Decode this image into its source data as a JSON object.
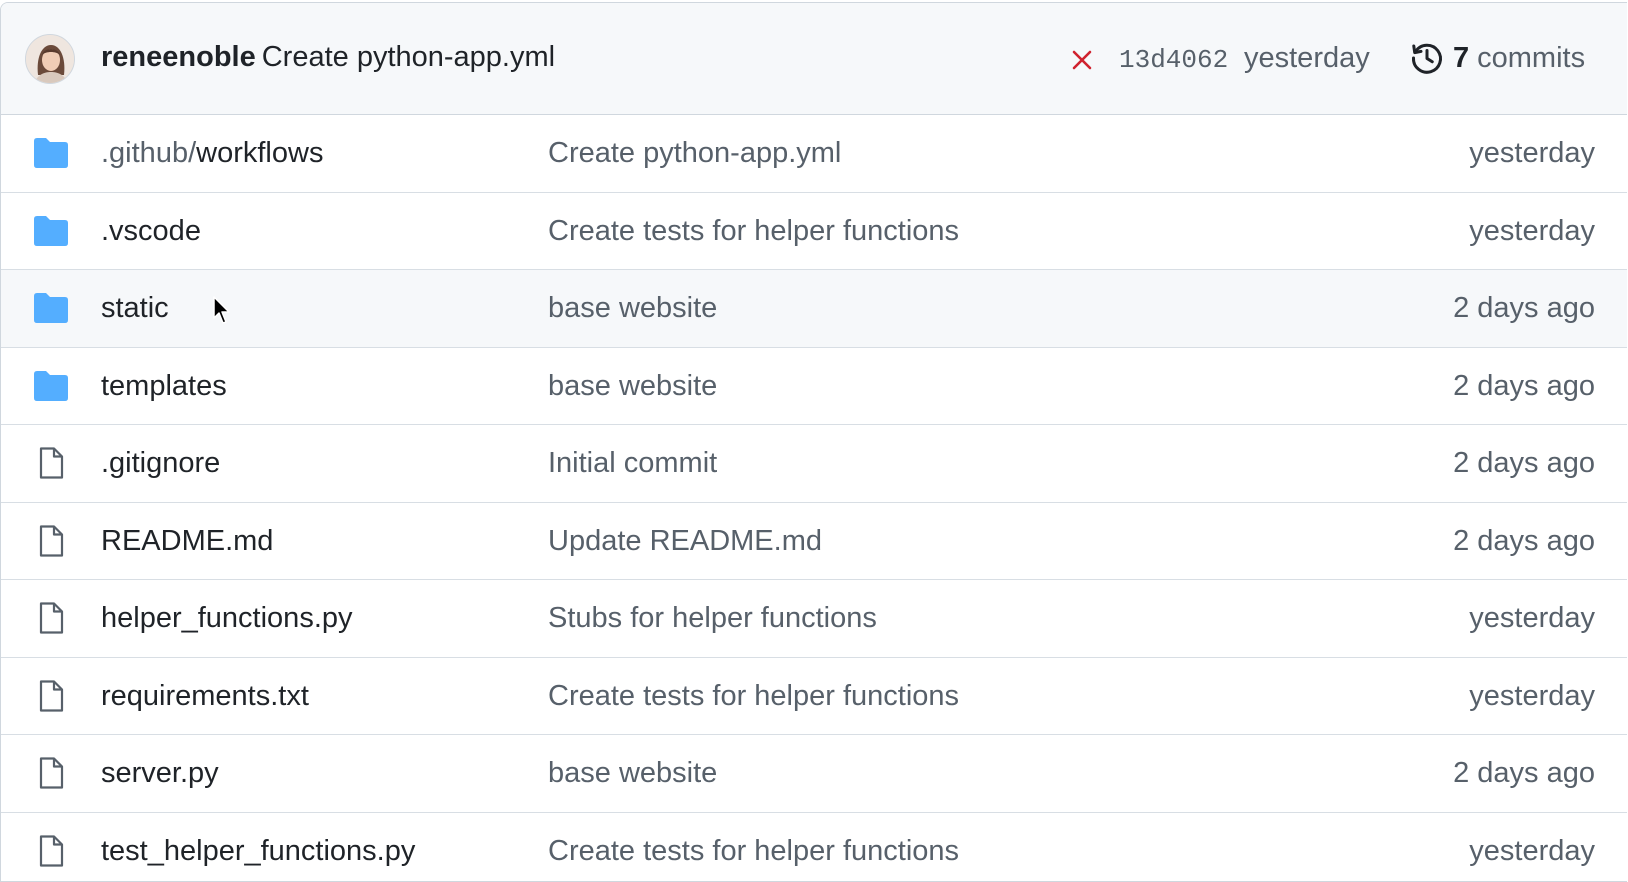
{
  "latest_commit": {
    "author": "reneenoble",
    "message": "Create python-app.yml",
    "status_icon": "x-icon",
    "status_color": "#cf222e",
    "sha": "13d4062",
    "time": "yesterday",
    "commit_count": "7",
    "commits_label": "commits"
  },
  "files": [
    {
      "type": "folder",
      "name_dim": ".github/",
      "name": "workflows",
      "message": "Create python-app.yml",
      "age": "yesterday"
    },
    {
      "type": "folder",
      "name_dim": "",
      "name": ".vscode",
      "message": "Create tests for helper functions",
      "age": "yesterday"
    },
    {
      "type": "folder",
      "name_dim": "",
      "name": "static",
      "message": "base website",
      "age": "2 days ago"
    },
    {
      "type": "folder",
      "name_dim": "",
      "name": "templates",
      "message": "base website",
      "age": "2 days ago"
    },
    {
      "type": "file",
      "name_dim": "",
      "name": ".gitignore",
      "message": "Initial commit",
      "age": "2 days ago"
    },
    {
      "type": "file",
      "name_dim": "",
      "name": "README.md",
      "message": "Update README.md",
      "age": "2 days ago"
    },
    {
      "type": "file",
      "name_dim": "",
      "name": "helper_functions.py",
      "message": "Stubs for helper functions",
      "age": "yesterday"
    },
    {
      "type": "file",
      "name_dim": "",
      "name": "requirements.txt",
      "message": "Create tests for helper functions",
      "age": "yesterday"
    },
    {
      "type": "file",
      "name_dim": "",
      "name": "server.py",
      "message": "base website",
      "age": "2 days ago"
    },
    {
      "type": "file",
      "name_dim": "",
      "name": "test_helper_functions.py",
      "message": "Create tests for helper functions",
      "age": "yesterday"
    }
  ],
  "colors": {
    "folder": "#54aeff",
    "file_icon": "#57606a",
    "header_bg": "#f6f8fa",
    "hover_row_bg": "#f6f8fa"
  }
}
